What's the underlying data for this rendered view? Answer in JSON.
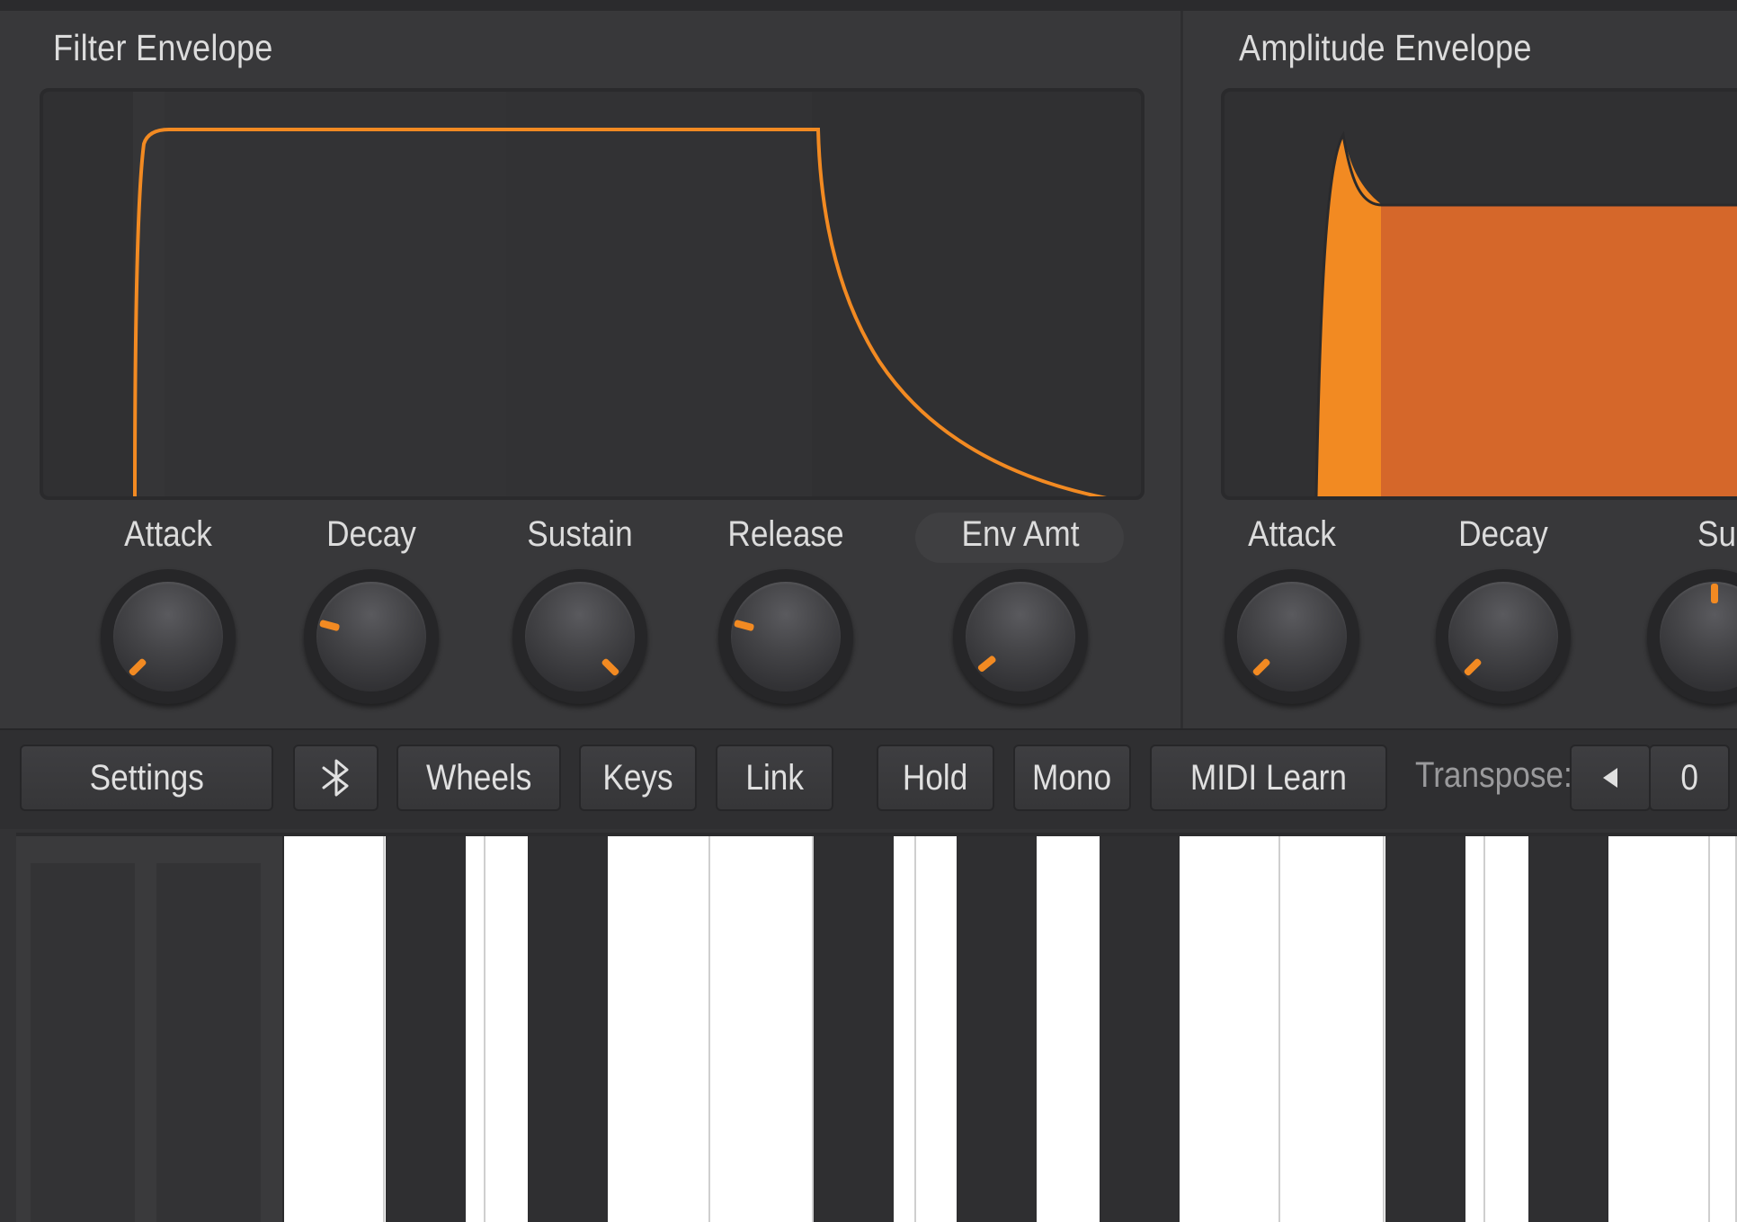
{
  "colors": {
    "accent": "#f28a22",
    "fill": "#d5672a",
    "fill_attack": "#f28a22",
    "background": "#38383a"
  },
  "filter_envelope": {
    "title": "Filter Envelope",
    "knobs": [
      {
        "label": "Attack",
        "value": 0.05
      },
      {
        "label": "Decay",
        "value": 0.25
      },
      {
        "label": "Sustain",
        "value": 0.95
      },
      {
        "label": "Release",
        "value": 0.25
      },
      {
        "label": "Env Amt",
        "value": 0.07
      }
    ]
  },
  "amplitude_envelope": {
    "title": "Amplitude Envelope",
    "knobs": [
      {
        "label": "Attack",
        "value": 0.05
      },
      {
        "label": "Decay",
        "value": 0.05
      },
      {
        "label": "Susta",
        "value": 0.5
      }
    ]
  },
  "toolbar": {
    "settings": "Settings",
    "bluetooth_icon": "bluetooth-icon",
    "wheels": "Wheels",
    "keys": "Keys",
    "link": "Link",
    "hold": "Hold",
    "mono": "Mono",
    "midi_learn": "MIDI Learn",
    "transpose_label": "Transpose:",
    "transpose_value": "0",
    "transpose_down_icon": "triangle-left-icon"
  }
}
